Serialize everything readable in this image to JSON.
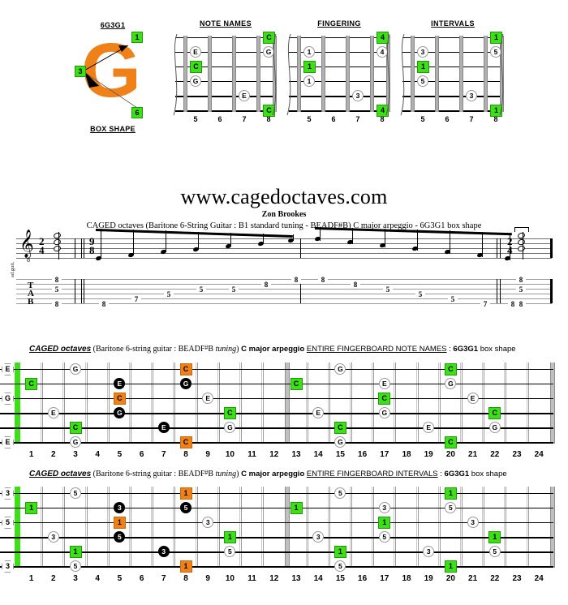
{
  "top": {
    "box_name": "6G3G1",
    "box_caption": "BOX SHAPE",
    "logo_letter": "G",
    "logo_labels": [
      "1",
      "3",
      "6"
    ],
    "diagrams": [
      {
        "title": "NOTE NAMES",
        "frets": [
          "5",
          "6",
          "7",
          "8"
        ],
        "notes": [
          {
            "string": 1,
            "fret": 8,
            "label": "C",
            "type": "green"
          },
          {
            "string": 2,
            "fret": 5,
            "label": "E",
            "type": "open"
          },
          {
            "string": 2,
            "fret": 8,
            "label": "G",
            "type": "open"
          },
          {
            "string": 3,
            "fret": 5,
            "label": "C",
            "type": "green"
          },
          {
            "string": 4,
            "fret": 5,
            "label": "G",
            "type": "open"
          },
          {
            "string": 5,
            "fret": 7,
            "label": "E",
            "type": "open"
          },
          {
            "string": 6,
            "fret": 8,
            "label": "C",
            "type": "green"
          }
        ]
      },
      {
        "title": "FINGERING",
        "frets": [
          "5",
          "6",
          "7",
          "8"
        ],
        "notes": [
          {
            "string": 1,
            "fret": 8,
            "label": "4",
            "type": "green"
          },
          {
            "string": 2,
            "fret": 5,
            "label": "1",
            "type": "open"
          },
          {
            "string": 2,
            "fret": 8,
            "label": "4",
            "type": "open"
          },
          {
            "string": 3,
            "fret": 5,
            "label": "1",
            "type": "green"
          },
          {
            "string": 4,
            "fret": 5,
            "label": "1",
            "type": "open"
          },
          {
            "string": 5,
            "fret": 7,
            "label": "3",
            "type": "open"
          },
          {
            "string": 6,
            "fret": 8,
            "label": "4",
            "type": "green"
          }
        ]
      },
      {
        "title": "INTERVALS",
        "frets": [
          "5",
          "6",
          "7",
          "8"
        ],
        "notes": [
          {
            "string": 1,
            "fret": 8,
            "label": "1",
            "type": "green"
          },
          {
            "string": 2,
            "fret": 5,
            "label": "3",
            "type": "open"
          },
          {
            "string": 2,
            "fret": 8,
            "label": "5",
            "type": "open"
          },
          {
            "string": 3,
            "fret": 5,
            "label": "1",
            "type": "green"
          },
          {
            "string": 4,
            "fret": 5,
            "label": "5",
            "type": "open"
          },
          {
            "string": 5,
            "fret": 7,
            "label": "3",
            "type": "open"
          },
          {
            "string": 6,
            "fret": 8,
            "label": "1",
            "type": "green"
          }
        ]
      }
    ]
  },
  "site": {
    "url": "www.cagedoctaves.com",
    "author": "Zon Brookes",
    "subtitle": "CAGED octaves (Baritone 6-String Guitar : B1 standard tuning - BEADF#B) C major arpeggio - 6G3G1 box shape"
  },
  "notation": {
    "instrument_label": "ad.guit.",
    "tab_letters": [
      "T",
      "A",
      "B"
    ],
    "time_signature_top": "2",
    "time_signature_bottom": "4",
    "pickup_time_top": "9",
    "pickup_time_bottom": "8",
    "final_time_top": "2",
    "final_time_bottom": "4",
    "opening_chord": [
      "8",
      "5",
      "8"
    ],
    "closing_chord": [
      "8",
      "5",
      "8"
    ],
    "ascending_tab": [
      "8",
      "7",
      "5",
      "5",
      "5",
      "8",
      "8"
    ],
    "descending_tab": [
      "8",
      "8",
      "5",
      "5",
      "5",
      "7",
      "8"
    ]
  },
  "fretboards": [
    {
      "header": {
        "caged": "CAGED octaves",
        "paren": "(Baritone 6-string guitar : BEADF",
        "sharp": "#",
        "paren2": "B ",
        "tuning_word": "tuning",
        "paren3": ")",
        "arpeggio": "C major arpeggio",
        "section": "ENTIRE FINGERBOARD NOTE NAMES",
        "colon": " : ",
        "box": "6G3G1",
        "box_suffix": " box shape"
      },
      "fret_numbers": [
        "1",
        "2",
        "3",
        "4",
        "5",
        "6",
        "7",
        "8",
        "9",
        "10",
        "11",
        "12",
        "13",
        "14",
        "15",
        "16",
        "17",
        "18",
        "19",
        "20",
        "21",
        "22",
        "23",
        "24"
      ],
      "open_notes": [
        "E",
        "",
        "G",
        "",
        "",
        "E"
      ],
      "notes": [
        {
          "string": 1,
          "fret": 3,
          "label": "G",
          "type": "open"
        },
        {
          "string": 1,
          "fret": 8,
          "label": "C",
          "type": "orange"
        },
        {
          "string": 1,
          "fret": 15,
          "label": "G",
          "type": "open"
        },
        {
          "string": 1,
          "fret": 20,
          "label": "C",
          "type": "green"
        },
        {
          "string": 2,
          "fret": 1,
          "label": "C",
          "type": "green"
        },
        {
          "string": 2,
          "fret": 5,
          "label": "E",
          "type": "black"
        },
        {
          "string": 2,
          "fret": 8,
          "label": "G",
          "type": "black"
        },
        {
          "string": 2,
          "fret": 13,
          "label": "C",
          "type": "green"
        },
        {
          "string": 2,
          "fret": 17,
          "label": "E",
          "type": "open"
        },
        {
          "string": 2,
          "fret": 20,
          "label": "G",
          "type": "open"
        },
        {
          "string": 3,
          "fret": 5,
          "label": "C",
          "type": "orange"
        },
        {
          "string": 3,
          "fret": 9,
          "label": "E",
          "type": "open"
        },
        {
          "string": 3,
          "fret": 17,
          "label": "C",
          "type": "green"
        },
        {
          "string": 3,
          "fret": 21,
          "label": "E",
          "type": "open"
        },
        {
          "string": 4,
          "fret": 2,
          "label": "E",
          "type": "open"
        },
        {
          "string": 4,
          "fret": 5,
          "label": "G",
          "type": "black"
        },
        {
          "string": 4,
          "fret": 10,
          "label": "C",
          "type": "green"
        },
        {
          "string": 4,
          "fret": 14,
          "label": "E",
          "type": "open"
        },
        {
          "string": 4,
          "fret": 17,
          "label": "G",
          "type": "open"
        },
        {
          "string": 4,
          "fret": 22,
          "label": "C",
          "type": "green"
        },
        {
          "string": 5,
          "fret": 3,
          "label": "C",
          "type": "green"
        },
        {
          "string": 5,
          "fret": 7,
          "label": "E",
          "type": "black"
        },
        {
          "string": 5,
          "fret": 10,
          "label": "G",
          "type": "open"
        },
        {
          "string": 5,
          "fret": 15,
          "label": "C",
          "type": "green"
        },
        {
          "string": 5,
          "fret": 19,
          "label": "E",
          "type": "open"
        },
        {
          "string": 5,
          "fret": 22,
          "label": "G",
          "type": "open"
        },
        {
          "string": 6,
          "fret": 3,
          "label": "G",
          "type": "open"
        },
        {
          "string": 6,
          "fret": 8,
          "label": "C",
          "type": "orange"
        },
        {
          "string": 6,
          "fret": 15,
          "label": "G",
          "type": "open"
        },
        {
          "string": 6,
          "fret": 20,
          "label": "C",
          "type": "green"
        }
      ]
    },
    {
      "header": {
        "caged": "CAGED octaves",
        "paren": "(Baritone 6-string guitar : BEADF",
        "sharp": "#",
        "paren2": "B ",
        "tuning_word": "tuning",
        "paren3": ")",
        "arpeggio": "C major arpeggio",
        "section": "ENTIRE FINGERBOARD INTERVALS",
        "colon": " : ",
        "box": "6G3G1",
        "box_suffix": " box shape"
      },
      "fret_numbers": [
        "1",
        "2",
        "3",
        "4",
        "5",
        "6",
        "7",
        "8",
        "9",
        "10",
        "11",
        "12",
        "13",
        "14",
        "15",
        "16",
        "17",
        "18",
        "19",
        "20",
        "21",
        "22",
        "23",
        "24"
      ],
      "open_notes": [
        "3",
        "",
        "5",
        "",
        "",
        "3"
      ],
      "notes": [
        {
          "string": 1,
          "fret": 3,
          "label": "5",
          "type": "open"
        },
        {
          "string": 1,
          "fret": 8,
          "label": "1",
          "type": "orange"
        },
        {
          "string": 1,
          "fret": 15,
          "label": "5",
          "type": "open"
        },
        {
          "string": 1,
          "fret": 20,
          "label": "1",
          "type": "green"
        },
        {
          "string": 2,
          "fret": 1,
          "label": "1",
          "type": "green"
        },
        {
          "string": 2,
          "fret": 5,
          "label": "3",
          "type": "black"
        },
        {
          "string": 2,
          "fret": 8,
          "label": "5",
          "type": "black"
        },
        {
          "string": 2,
          "fret": 13,
          "label": "1",
          "type": "green"
        },
        {
          "string": 2,
          "fret": 17,
          "label": "3",
          "type": "open"
        },
        {
          "string": 2,
          "fret": 20,
          "label": "5",
          "type": "open"
        },
        {
          "string": 3,
          "fret": 5,
          "label": "1",
          "type": "orange"
        },
        {
          "string": 3,
          "fret": 9,
          "label": "3",
          "type": "open"
        },
        {
          "string": 3,
          "fret": 17,
          "label": "1",
          "type": "green"
        },
        {
          "string": 3,
          "fret": 21,
          "label": "3",
          "type": "open"
        },
        {
          "string": 4,
          "fret": 2,
          "label": "3",
          "type": "open"
        },
        {
          "string": 4,
          "fret": 5,
          "label": "5",
          "type": "black"
        },
        {
          "string": 4,
          "fret": 10,
          "label": "1",
          "type": "green"
        },
        {
          "string": 4,
          "fret": 14,
          "label": "3",
          "type": "open"
        },
        {
          "string": 4,
          "fret": 17,
          "label": "5",
          "type": "open"
        },
        {
          "string": 4,
          "fret": 22,
          "label": "1",
          "type": "green"
        },
        {
          "string": 5,
          "fret": 3,
          "label": "1",
          "type": "green"
        },
        {
          "string": 5,
          "fret": 7,
          "label": "3",
          "type": "black"
        },
        {
          "string": 5,
          "fret": 10,
          "label": "5",
          "type": "open"
        },
        {
          "string": 5,
          "fret": 15,
          "label": "1",
          "type": "green"
        },
        {
          "string": 5,
          "fret": 19,
          "label": "3",
          "type": "open"
        },
        {
          "string": 5,
          "fret": 22,
          "label": "5",
          "type": "open"
        },
        {
          "string": 6,
          "fret": 3,
          "label": "5",
          "type": "open"
        },
        {
          "string": 6,
          "fret": 8,
          "label": "1",
          "type": "orange"
        },
        {
          "string": 6,
          "fret": 15,
          "label": "5",
          "type": "open"
        },
        {
          "string": 6,
          "fret": 20,
          "label": "1",
          "type": "green"
        }
      ]
    }
  ],
  "colors": {
    "green": "#3BE017",
    "orange": "#F08018",
    "black": "#000000",
    "white": "#FFFFFF",
    "nut": "#3BE017"
  }
}
